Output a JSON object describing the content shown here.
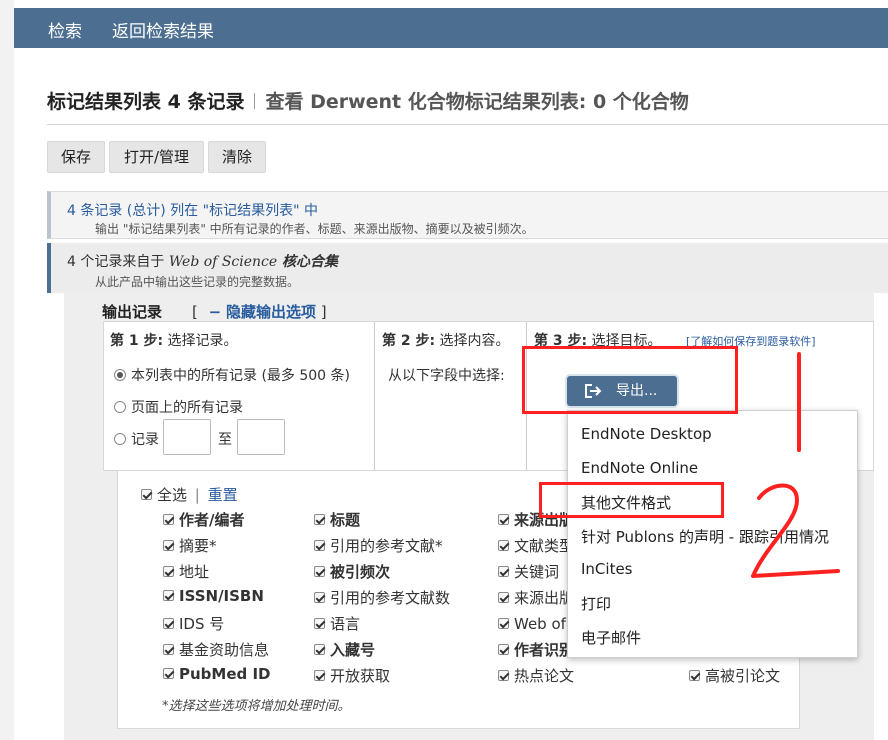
{
  "nav": {
    "search": "检索",
    "back": "返回检索结果"
  },
  "header": {
    "title": "标记结果列表 4 条记录",
    "subtitle": "查看 Derwent 化合物标记结果列表: 0 个化合物"
  },
  "toolbar": {
    "save": "保存",
    "open_manage": "打开/管理",
    "clear": "清除"
  },
  "section1": {
    "title": "4 条记录 (总计) 列在 \"标记结果列表\" 中",
    "desc": "输出 \"标记结果列表\" 中所有记录的作者、标题、来源出版物、摘要以及被引频次。"
  },
  "section2": {
    "prefix": "4 个记录来自于 ",
    "product": "Web of Science",
    "product_suffix": " 核心合集",
    "desc": "从此产品中输出这些记录的完整数据。"
  },
  "output": {
    "title": "输出记录",
    "toggle_open": "[",
    "toggle_dash": "−",
    "toggle_label": "隐藏输出选项",
    "toggle_close": "]"
  },
  "step1": {
    "label": "第 1 步:",
    "text": "选择记录。",
    "options": [
      "本列表中的所有记录 (最多 500 条)",
      "页面上的所有记录",
      "记录"
    ],
    "to": "至"
  },
  "step2": {
    "label": "第 2 步:",
    "text": "选择内容。",
    "from_fields": "从以下字段中选择:"
  },
  "step3": {
    "label": "第 3 步:",
    "text": "选择目标。",
    "help": "[了解如何保存到题录软件]"
  },
  "export_button": "导出...",
  "fields": {
    "select_all": "全选",
    "divider": "|",
    "reset": "重置",
    "items": [
      "作者/编者",
      "标题",
      "来源出版物",
      "摘要*",
      "引用的参考文献*",
      "文献类型",
      "地址",
      "被引频次",
      "关键词",
      "ISSN/ISBN",
      "引用的参考文献数",
      "来源出版物缩写",
      "IDS 号",
      "语言",
      "Web of Science 类别",
      "基金资助信息",
      "入藏号",
      "作者识别号",
      "PubMed ID",
      "开放获取",
      "热点论文",
      "高被引论文"
    ],
    "note": "*选择这些选项将增加处理时间。"
  },
  "dropdown": [
    "EndNote Desktop",
    "EndNote Online",
    "其他文件格式",
    "针对 Publons 的声明 - 跟踪引用情况",
    "InCites",
    "打印",
    "电子邮件"
  ],
  "annotations": {
    "stroke_color": "#ff2020",
    "number_label": "2"
  }
}
